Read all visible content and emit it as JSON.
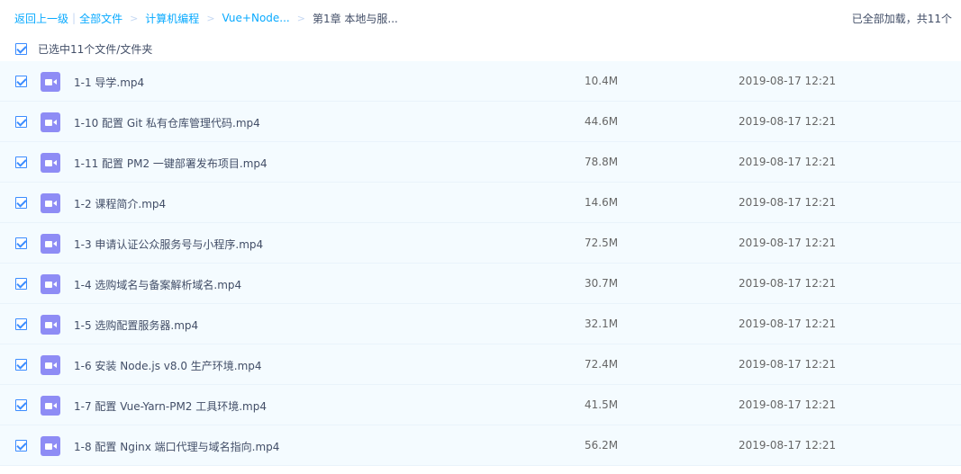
{
  "header": {
    "back": "返回上一级",
    "sep": "|",
    "crumbs": [
      "全部文件",
      "计算机编程",
      "Vue+Node..."
    ],
    "arrow": ">",
    "current": "第1章 本地与服...",
    "status": "已全部加载，共11个"
  },
  "selection": {
    "label": "已选中11个文件/文件夹",
    "checked": true
  },
  "files": [
    {
      "name": "1-1 导学.mp4",
      "size": "10.4M",
      "date": "2019-08-17 12:21"
    },
    {
      "name": "1-10 配置 Git 私有仓库管理代码.mp4",
      "size": "44.6M",
      "date": "2019-08-17 12:21"
    },
    {
      "name": "1-11 配置 PM2 一键部署发布项目.mp4",
      "size": "78.8M",
      "date": "2019-08-17 12:21"
    },
    {
      "name": "1-2 课程简介.mp4",
      "size": "14.6M",
      "date": "2019-08-17 12:21"
    },
    {
      "name": "1-3 申请认证公众服务号与小程序.mp4",
      "size": "72.5M",
      "date": "2019-08-17 12:21"
    },
    {
      "name": "1-4 选购域名与备案解析域名.mp4",
      "size": "30.7M",
      "date": "2019-08-17 12:21"
    },
    {
      "name": "1-5 选购配置服务器.mp4",
      "size": "32.1M",
      "date": "2019-08-17 12:21"
    },
    {
      "name": "1-6 安装 Node.js v8.0 生产环境.mp4",
      "size": "72.4M",
      "date": "2019-08-17 12:21"
    },
    {
      "name": "1-7 配置 Vue-Yarn-PM2 工具环境.mp4",
      "size": "41.5M",
      "date": "2019-08-17 12:21"
    },
    {
      "name": "1-8 配置 Nginx 端口代理与域名指向.mp4",
      "size": "56.2M",
      "date": "2019-08-17 12:21"
    }
  ],
  "icon": "video-file-icon",
  "colors": {
    "accent": "#09aaff",
    "row_bg": "#f4fbff",
    "icon_bg": "#8e8cf5",
    "checkbox": "#3b8cff"
  }
}
